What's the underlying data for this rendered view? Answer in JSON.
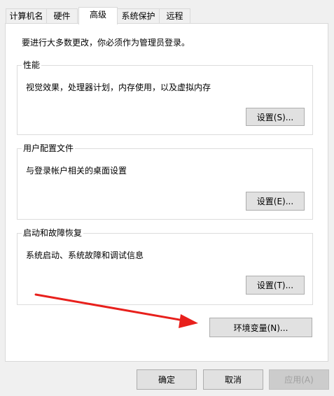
{
  "tabs": [
    {
      "label": "计算机名",
      "active": false
    },
    {
      "label": "硬件",
      "active": false
    },
    {
      "label": "高级",
      "active": true
    },
    {
      "label": "系统保护",
      "active": false
    },
    {
      "label": "远程",
      "active": false
    }
  ],
  "notice": "要进行大多数更改，你必须作为管理员登录。",
  "groups": {
    "performance": {
      "title": "性能",
      "description": "视觉效果，处理器计划，内存使用，以及虚拟内存",
      "button": "设置(S)..."
    },
    "user_profiles": {
      "title": "用户配置文件",
      "description": "与登录帐户相关的桌面设置",
      "button": "设置(E)..."
    },
    "startup_recovery": {
      "title": "启动和故障恢复",
      "description": "系统启动、系统故障和调试信息",
      "button": "设置(T)..."
    }
  },
  "env_button": "环境变量(N)...",
  "footer": {
    "ok": "确定",
    "cancel": "取消",
    "apply": "应用(A)"
  },
  "colors": {
    "annotation_arrow": "#e8201c"
  }
}
